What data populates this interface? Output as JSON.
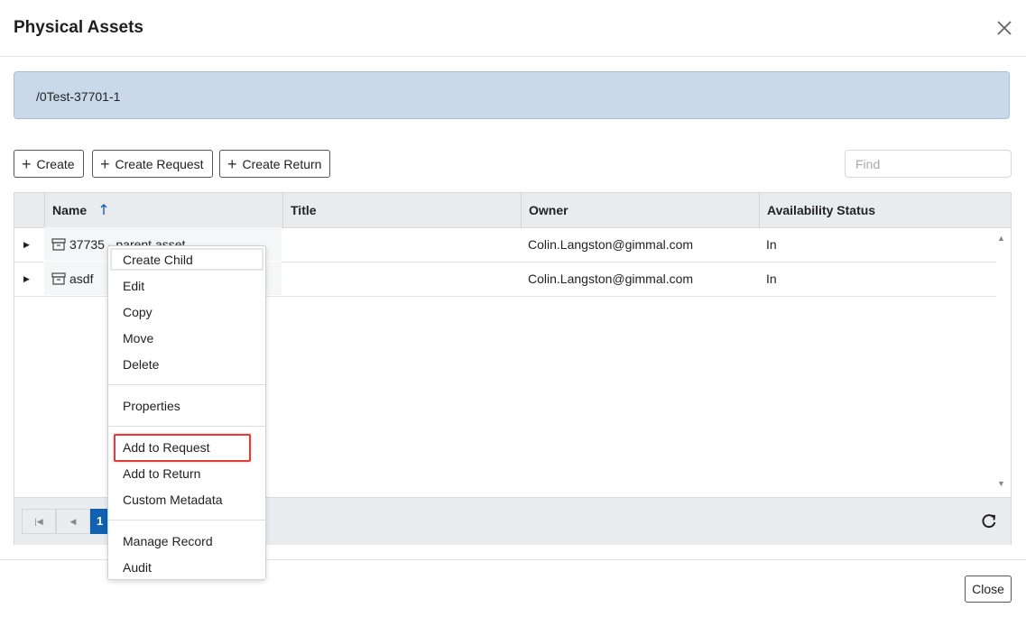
{
  "dialog": {
    "title": "Physical Assets",
    "close_icon": "close-icon"
  },
  "path": "/0Test-37701-1",
  "toolbar": {
    "create_label": "Create",
    "create_request_label": "Create Request",
    "create_return_label": "Create Return",
    "find_placeholder": "Find"
  },
  "grid": {
    "columns": [
      "Name",
      "Title",
      "Owner",
      "Availability Status"
    ],
    "sort_icon": "sort-ascending-icon",
    "rows": [
      {
        "name": "37735 - parent asset",
        "title": "",
        "owner": "Colin.Langston@gimmal.com",
        "status": "In"
      },
      {
        "name": "asdf",
        "title": "",
        "owner": "Colin.Langston@gimmal.com",
        "status": "In"
      }
    ]
  },
  "pager": {
    "current_page": "1"
  },
  "context_menu": {
    "items": [
      "Create Child",
      "Edit",
      "Copy",
      "Move",
      "Delete",
      "Properties",
      "Add to Request",
      "Add to Return",
      "Custom Metadata",
      "Manage Record",
      "Audit"
    ],
    "highlighted": "Add to Request"
  },
  "footer": {
    "close_label": "Close"
  },
  "colors": {
    "accent": "#1261b0",
    "highlight": "#e23b3b",
    "path_bg": "#cad9ea"
  }
}
